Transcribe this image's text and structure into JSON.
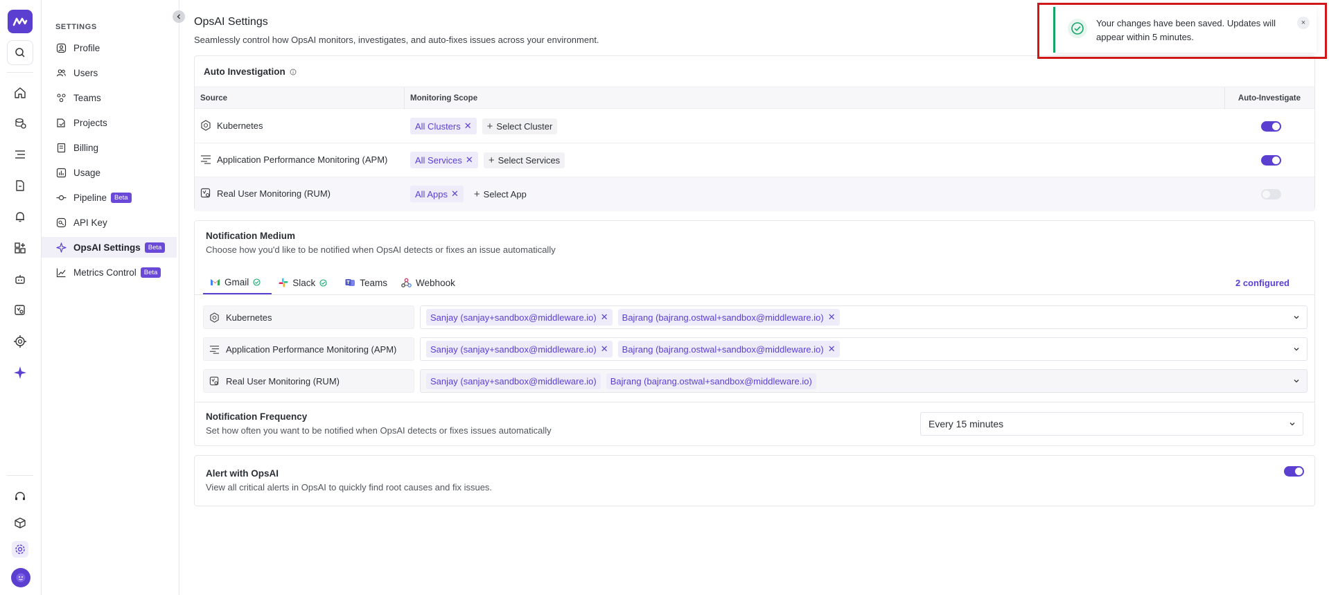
{
  "sidebar": {
    "header": "SETTINGS",
    "items": [
      {
        "label": "Profile"
      },
      {
        "label": "Users"
      },
      {
        "label": "Teams"
      },
      {
        "label": "Projects"
      },
      {
        "label": "Billing"
      },
      {
        "label": "Usage"
      },
      {
        "label": "Pipeline",
        "badge": "Beta"
      },
      {
        "label": "API Key"
      },
      {
        "label": "OpsAI Settings",
        "badge": "Beta",
        "active": true
      },
      {
        "label": "Metrics Control",
        "badge": "Beta"
      }
    ]
  },
  "page": {
    "title": "OpsAI Settings",
    "description": "Seamlessly control how OpsAI monitors, investigates, and auto-fixes issues across your environment."
  },
  "auto_investigation": {
    "title": "Auto Investigation",
    "columns": {
      "source": "Source",
      "scope": "Monitoring Scope",
      "auto": "Auto-Investigate"
    },
    "rows": [
      {
        "source": "Kubernetes",
        "chip": "All Clusters",
        "add": "Select Cluster",
        "enabled": true
      },
      {
        "source": "Application Performance Monitoring (APM)",
        "chip": "All Services",
        "add": "Select Services",
        "enabled": true
      },
      {
        "source": "Real User Monitoring (RUM)",
        "chip": "All Apps",
        "add": "Select App",
        "enabled": false
      }
    ]
  },
  "notification_medium": {
    "title": "Notification Medium",
    "description": "Choose how you'd like to be notified when OpsAI detects or fixes an issue automatically",
    "tabs": [
      {
        "label": "Gmail",
        "configured": true,
        "active": true
      },
      {
        "label": "Slack",
        "configured": true
      },
      {
        "label": "Teams"
      },
      {
        "label": "Webhook"
      }
    ],
    "configured_count": "2 configured",
    "rows": [
      {
        "source": "Kubernetes",
        "recipients": [
          "Sanjay (sanjay+sandbox@middleware.io)",
          "Bajrang (bajrang.ostwal+sandbox@middleware.io)"
        ]
      },
      {
        "source": "Application Performance Monitoring (APM)",
        "recipients": [
          "Sanjay (sanjay+sandbox@middleware.io)",
          "Bajrang (bajrang.ostwal+sandbox@middleware.io)"
        ]
      },
      {
        "source": "Real User Monitoring (RUM)",
        "recipients": [
          "Sanjay (sanjay+sandbox@middleware.io)",
          "Bajrang (bajrang.ostwal+sandbox@middleware.io)"
        ]
      }
    ]
  },
  "notification_frequency": {
    "title": "Notification Frequency",
    "description": "Set how often you want to be notified when OpsAI detects or fixes issues automatically",
    "value": "Every 15 minutes"
  },
  "alert_with_opsai": {
    "title": "Alert with OpsAI",
    "description": "View all critical alerts in OpsAI to quickly find root causes and fix issues.",
    "enabled": true
  },
  "toast": {
    "message": "Your changes have been saved. Updates will appear within 5 minutes.",
    "close": "×"
  },
  "colors": {
    "accent": "#5b3fd1",
    "success": "#16a36a",
    "highlight": "#d01818"
  }
}
